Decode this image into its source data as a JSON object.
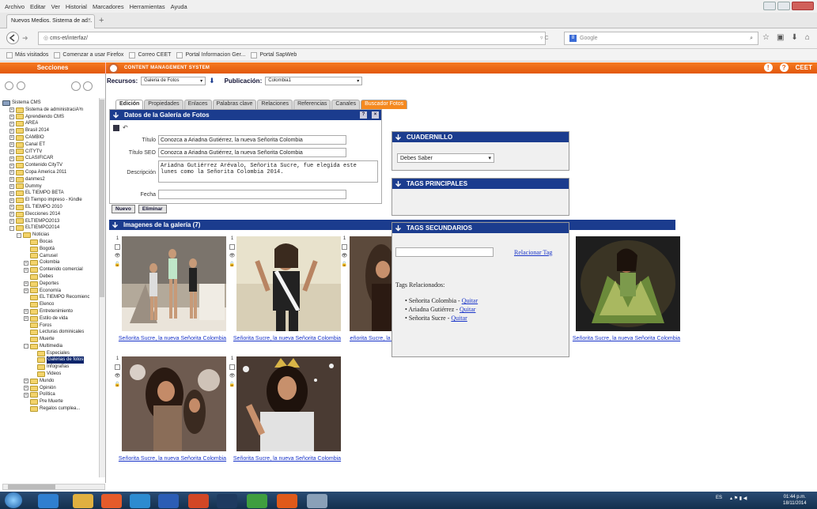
{
  "browser": {
    "menu": [
      "Archivo",
      "Editar",
      "Ver",
      "Historial",
      "Marcadores",
      "Herramientas",
      "Ayuda"
    ],
    "tab_title": "Nuevos Medios. Sistema de ad...",
    "tab_close": "×",
    "new_tab": "+",
    "url": "cms-et/interfaz/",
    "search_engine": "Google",
    "bookmarks": [
      "Más visitados",
      "Comenzar a usar Firefox",
      "Correo CEET",
      "Portal Informacion Ger...",
      "Portal SapWeb"
    ]
  },
  "cms": {
    "sections_label": "Secciones",
    "app_title": "CONTENT MANAGEMENT SYSTEM",
    "user_badge": "CEET",
    "resources_label": "Recursos:",
    "resources_value": "Galeria de Fotos",
    "publication_label": "Publicación:",
    "publication_value": "Colombia1"
  },
  "tree": [
    {
      "label": "Sistema CMS",
      "depth": 0,
      "pm": "",
      "folder": false
    },
    {
      "label": "Sistema de administraciÃ³n",
      "depth": 1,
      "pm": "+"
    },
    {
      "label": "Aprendiendo CMS",
      "depth": 1,
      "pm": "+"
    },
    {
      "label": "AREA",
      "depth": 1,
      "pm": "+"
    },
    {
      "label": "Brasil 2014",
      "depth": 1,
      "pm": "+"
    },
    {
      "label": "CAMBIO",
      "depth": 1,
      "pm": "+"
    },
    {
      "label": "Canal ET",
      "depth": 1,
      "pm": "+"
    },
    {
      "label": "CITYTV",
      "depth": 1,
      "pm": "+"
    },
    {
      "label": "CLASIFICAR",
      "depth": 1,
      "pm": "+"
    },
    {
      "label": "Contenido CityTV",
      "depth": 1,
      "pm": "+"
    },
    {
      "label": "Copa America 2011",
      "depth": 1,
      "pm": "+"
    },
    {
      "label": "danmes2",
      "depth": 1,
      "pm": "+"
    },
    {
      "label": "Dummy",
      "depth": 1,
      "pm": "+"
    },
    {
      "label": "EL TIEMPO BETA",
      "depth": 1,
      "pm": "+"
    },
    {
      "label": "El Tiempo impreso - Kindle",
      "depth": 1,
      "pm": "+"
    },
    {
      "label": "EL TIEMPO 2010",
      "depth": 1,
      "pm": "+"
    },
    {
      "label": "Elecciones 2014",
      "depth": 1,
      "pm": "+"
    },
    {
      "label": "ELTIEMPO2013",
      "depth": 1,
      "pm": "+"
    },
    {
      "label": "ELTIEMPO2014",
      "depth": 1,
      "pm": "-"
    },
    {
      "label": "Noticias",
      "depth": 2,
      "pm": "-"
    },
    {
      "label": "Bocas",
      "depth": 3,
      "pm": ""
    },
    {
      "label": "Bogotá",
      "depth": 3,
      "pm": ""
    },
    {
      "label": "Carrusel",
      "depth": 3,
      "pm": ""
    },
    {
      "label": "Colombia",
      "depth": 3,
      "pm": "+"
    },
    {
      "label": "Contenido comercial",
      "depth": 3,
      "pm": "+"
    },
    {
      "label": "Debes",
      "depth": 3,
      "pm": ""
    },
    {
      "label": "Deportes",
      "depth": 3,
      "pm": "+"
    },
    {
      "label": "Economía",
      "depth": 3,
      "pm": "+"
    },
    {
      "label": "EL TIEMPO Recomienc",
      "depth": 3,
      "pm": ""
    },
    {
      "label": "Elenco",
      "depth": 3,
      "pm": ""
    },
    {
      "label": "Entretenimiento",
      "depth": 3,
      "pm": "+"
    },
    {
      "label": "Estilo de vida",
      "depth": 3,
      "pm": "+"
    },
    {
      "label": "Foros",
      "depth": 3,
      "pm": ""
    },
    {
      "label": "Lecturas dominicales",
      "depth": 3,
      "pm": ""
    },
    {
      "label": "Muerte",
      "depth": 3,
      "pm": ""
    },
    {
      "label": "Multimedia",
      "depth": 3,
      "pm": "-"
    },
    {
      "label": "Especiales",
      "depth": 4,
      "pm": ""
    },
    {
      "label": "Galerias de fotos",
      "depth": 4,
      "pm": "",
      "selected": true
    },
    {
      "label": "Infografías",
      "depth": 4,
      "pm": ""
    },
    {
      "label": "Videos",
      "depth": 4,
      "pm": ""
    },
    {
      "label": "Mundo",
      "depth": 3,
      "pm": "+"
    },
    {
      "label": "Opinión",
      "depth": 3,
      "pm": "+"
    },
    {
      "label": "Política",
      "depth": 3,
      "pm": "+"
    },
    {
      "label": "Pre Muerte",
      "depth": 3,
      "pm": ""
    },
    {
      "label": "Regalos cumplea...",
      "depth": 3,
      "pm": ""
    }
  ],
  "tabs": [
    "Edición",
    "Propiedades",
    "Enlaces",
    "Palabras clave",
    "Relaciones",
    "Referencias",
    "Canales",
    "Buscador Fotos"
  ],
  "form": {
    "header": "Datos de la Galería de Fotos",
    "titulo_label": "Título",
    "titulo_value": "Conozca a Ariadna Gutiérrez, la nueva Señorita Colombia",
    "seo_label": "Título SEO",
    "seo_value": "Conozca a Ariadna Gutiérrez, la nueva Señorita Colombia",
    "desc_label": "Descripción",
    "desc_value": "Ariadna Gutiérrez Arévalo, Señorita Sucre, fue elegida este lunes como la Señorita Colombia 2014.",
    "fecha_label": "Fecha",
    "fecha_value": "",
    "nuevo": "Nuevo",
    "eliminar": "Eliminar"
  },
  "gallery": {
    "header": "Imagenes de la galería (7)",
    "index_label": "1",
    "caption": "Señorita Sucre, la nueva Señorita Colombia",
    "caption_cut": "Señorita Sucre, la nueva Señorita Colombia"
  },
  "cuadernillo": {
    "header": "CUADERNILLO",
    "value": "Debes Saber"
  },
  "tags_principales": {
    "header": "TAGS PRINCIPALES"
  },
  "tags_secundarios": {
    "header": "TAGS SECUNDARIOS",
    "link": "Relacionar Tag",
    "related_label": "Tags Relacionados:",
    "items": [
      "Señorita Colombia",
      "Ariadna Gutiérrez",
      "Señorita Sucre"
    ],
    "remove": "Quitar"
  },
  "taskbar": {
    "lang": "ES",
    "time": "01:44 p.m.",
    "date": "18/11/2014"
  },
  "colors": {
    "orange": "#f57a21",
    "navy": "#1b3c8e",
    "link": "#1a35c9"
  }
}
